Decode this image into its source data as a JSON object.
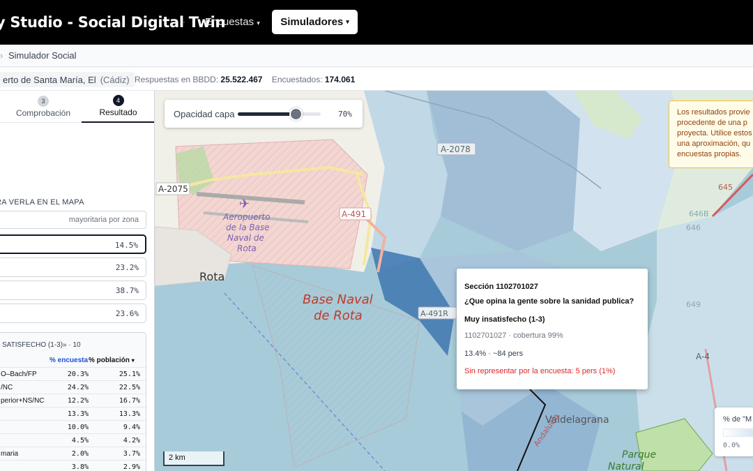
{
  "app": {
    "brand": "y Studio - Social Digital Twin",
    "brand_sep": "·",
    "nav_encuestas": "Encuestas",
    "nav_simuladores": "Simuladores"
  },
  "breadcrumb": {
    "sep": "›",
    "current": "Simulador Social"
  },
  "infobar": {
    "location": "erto de Santa María, El",
    "province": "(Cádiz)",
    "responses_label": "Respuestas en BBDD:",
    "responses_value": "25.522.467",
    "surveyed_label": "Encuestados:",
    "surveyed_value": "174.061"
  },
  "sidebar": {
    "steps": [
      {
        "num": "3",
        "label": "Comprobación"
      },
      {
        "num": "4",
        "label": "Resultado"
      }
    ],
    "section_label": "RA VERLA EN EL MAPA",
    "mode_chip": "mayoritaria por zona",
    "options": [
      "14.5%",
      "23.2%",
      "38.7%",
      "23.6%"
    ],
    "card": {
      "title": "SATISFECHO (1-3)» · 10",
      "col_encuesta": "% encuesta",
      "col_poblacion": "% población",
      "sort_icon": "▾",
      "rows": [
        {
          "label": "O–Bach/FP",
          "enc": "20.3%",
          "pob": "25.1%"
        },
        {
          "label": "/NC",
          "enc": "24.2%",
          "pob": "22.5%"
        },
        {
          "label": "perior+NS/NC",
          "enc": "12.2%",
          "pob": "16.7%"
        },
        {
          "label": "",
          "enc": "13.3%",
          "pob": "13.3%"
        },
        {
          "label": "",
          "enc": "10.0%",
          "pob": "9.4%"
        },
        {
          "label": "",
          "enc": "4.5%",
          "pob": "4.2%"
        },
        {
          "label": "maria",
          "enc": "2.0%",
          "pob": "3.7%"
        },
        {
          "label": "",
          "enc": "3.8%",
          "pob": "2.9%"
        }
      ]
    }
  },
  "map": {
    "opacity_label": "Opacidad capa",
    "opacity_value": "70%",
    "opacity_fraction": 0.7,
    "labels": {
      "rota": "Rota",
      "airport_1": "Aeropuerto",
      "airport_2": "de la Base",
      "airport_3": "Naval de",
      "airport_4": "Rota",
      "base_1": "Base Naval",
      "base_2": "de Rota",
      "road_a2075": "A-2075",
      "road_a491": "A-491",
      "road_a2078": "A-2078",
      "road_a491r": "A-491R",
      "road_a4": "A-4",
      "road_645": "645",
      "road_646": "646",
      "road_646b": "646B",
      "road_649": "649",
      "valdelagrana": "Valdelagrana",
      "andalucia": "Andalucía",
      "parque_1": "Parque",
      "parque_2": "Natural"
    },
    "note": "Los resultados provie procedente de una p proyecta. Utilice estos una aproximación, qu encuestas propias.",
    "popup": {
      "section": "Sección 1102701027",
      "question": "¿Que opina la gente sobre la sanidad publica?",
      "answer": "Muy insatisfecho (1-3)",
      "coverage": "1102701027 · cobertura 99%",
      "pct": "13.4% · ~84 pers",
      "warning": "Sin representar por la encuesta: 5 pers (1%)"
    },
    "scale": "2 km",
    "legend_title": "% de \"M",
    "legend_min": "0.0%"
  }
}
